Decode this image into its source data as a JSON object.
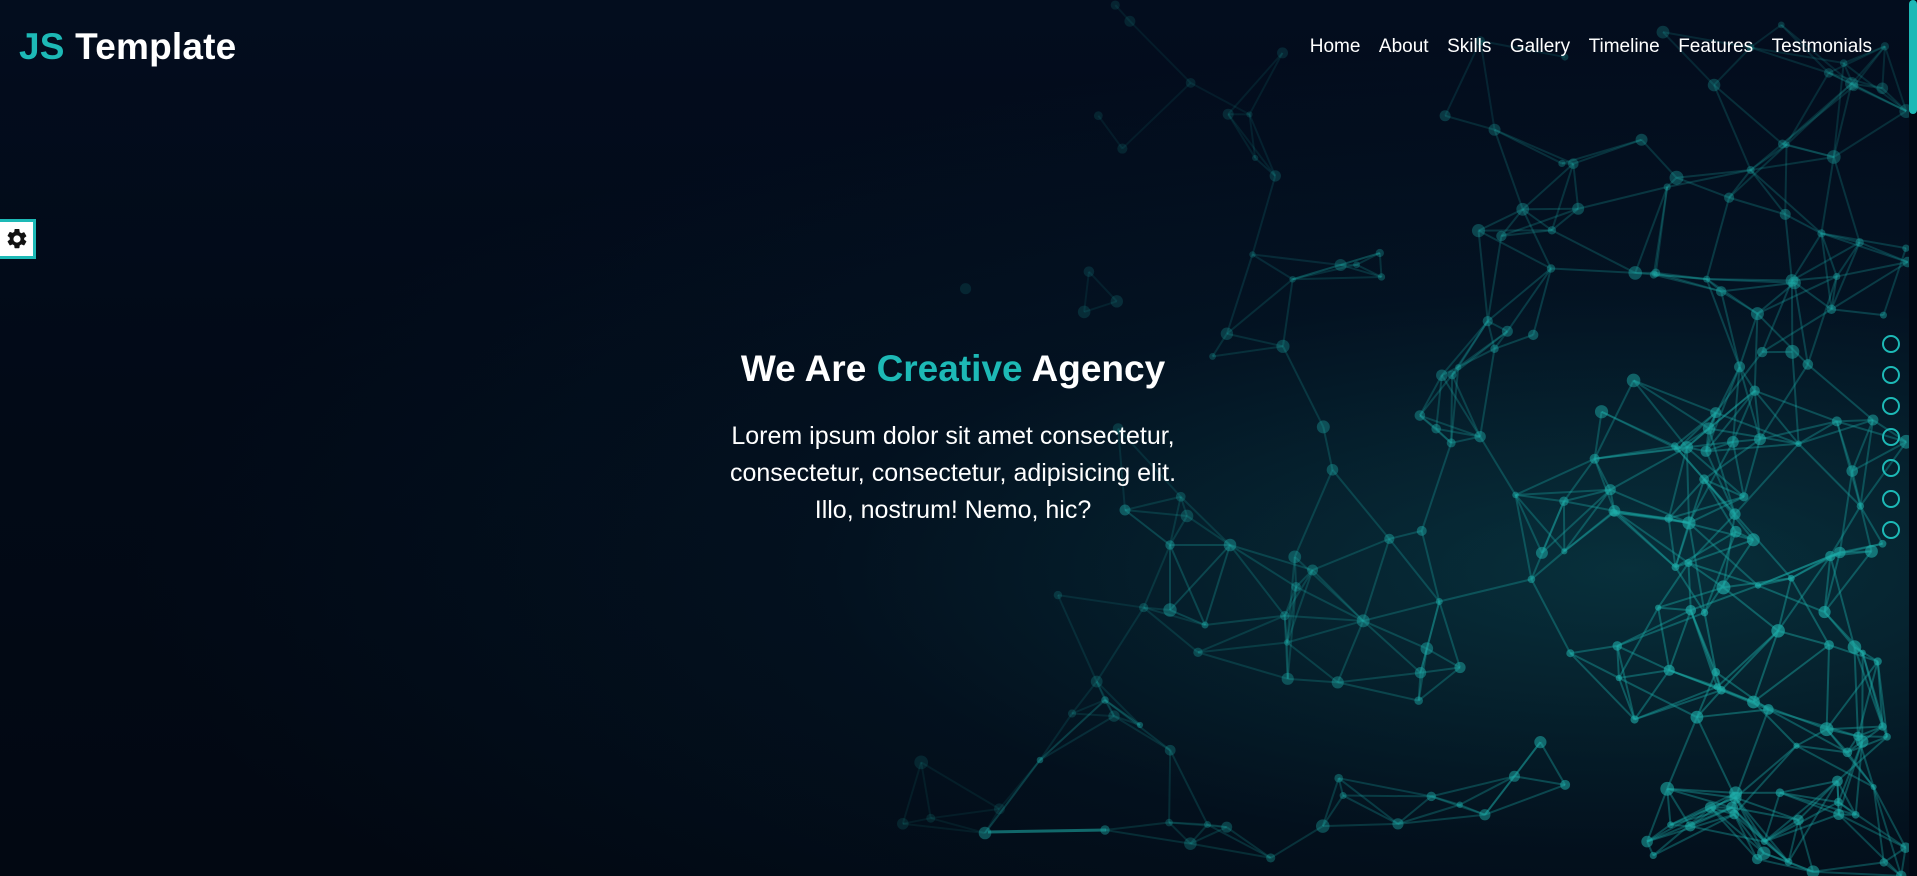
{
  "colors": {
    "accent": "#1db9b6",
    "background": "#020914",
    "text": "#ffffff"
  },
  "logo": {
    "accent_text": "JS",
    "text": "Template"
  },
  "nav": {
    "items": [
      {
        "label": "Home"
      },
      {
        "label": "About"
      },
      {
        "label": "Skills"
      },
      {
        "label": "Gallery"
      },
      {
        "label": "Timeline"
      },
      {
        "label": "Features"
      },
      {
        "label": "Testmonials"
      }
    ]
  },
  "settings": {
    "icon": "gear-icon"
  },
  "hero": {
    "title_before": "We Are ",
    "title_accent": "Creative",
    "title_after": " Agency",
    "description": "Lorem ipsum dolor sit amet consectetur, consectetur, consectetur, adipisicing elit. Illo, nostrum! Nemo, hic?"
  },
  "bullets": {
    "count_icon": "circle-outline-icon"
  }
}
